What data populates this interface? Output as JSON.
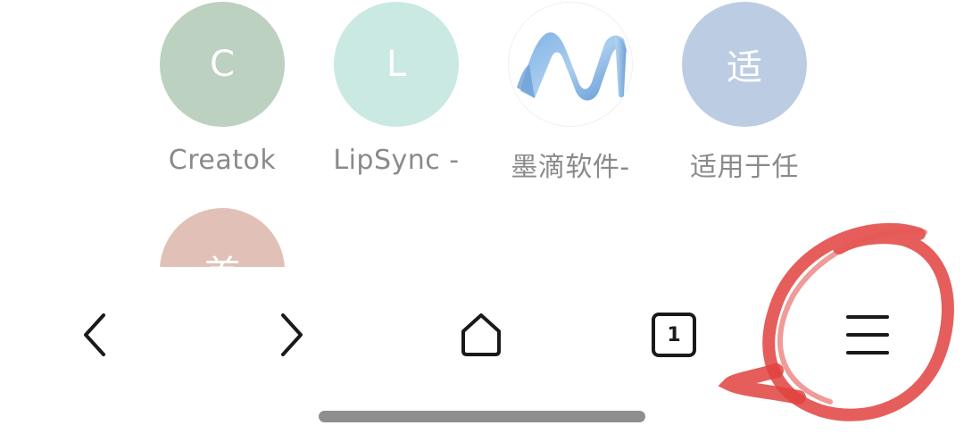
{
  "shortcuts": [
    {
      "label": "Creatok",
      "icon_text": "C",
      "icon_color": "#bcd1c0"
    },
    {
      "label": "LipSync -",
      "icon_text": "L",
      "icon_color": "#c9e9e2"
    },
    {
      "label": "墨滴软件-",
      "icon_text": "",
      "icon": "n-logo-icon"
    },
    {
      "label": "适用于任",
      "icon_text": "适",
      "icon_color": "#bccde3"
    },
    {
      "label": "",
      "icon_text": "首",
      "icon_color": "#e1c0b8"
    }
  ],
  "toolbar": {
    "back_icon": "chevron-left-icon",
    "forward_icon": "chevron-right-icon",
    "home_icon": "home-icon",
    "tabs_count": "1",
    "menu_icon": "hamburger-menu-icon"
  },
  "annotation": {
    "shape": "hand-drawn circle",
    "color": "#e0423e",
    "target": "menu-button"
  }
}
